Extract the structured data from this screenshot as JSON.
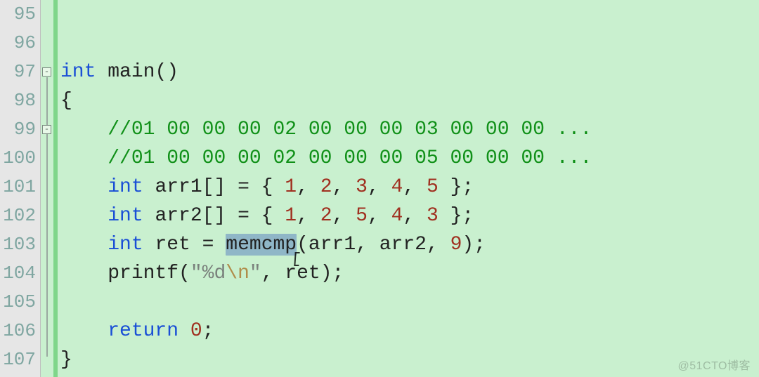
{
  "editor": {
    "line_numbers": [
      "95",
      "96",
      "97",
      "98",
      "99",
      "100",
      "101",
      "102",
      "103",
      "104",
      "105",
      "106",
      "107"
    ],
    "fold_markers": [
      {
        "line": 97,
        "glyph": "-"
      },
      {
        "line": 99,
        "glyph": "-"
      }
    ],
    "highlighted_token": "memcmp",
    "code_lines": {
      "l95": "",
      "l96": "",
      "l97": {
        "kw1": "int",
        "sp": " ",
        "id": "main",
        "pn": "()"
      },
      "l98": {
        "pn": "{"
      },
      "l99": {
        "cm": "//01 00 00 00 02 00 00 00 03 00 00 00 ..."
      },
      "l100": {
        "cm": "//01 00 00 00 02 00 00 00 05 00 00 00 ..."
      },
      "l101": {
        "kw": "int",
        "id": "arr1",
        "br": "[] = { ",
        "n1": "1",
        "n2": "2",
        "n3": "3",
        "n4": "4",
        "n5": "5",
        "end": " };"
      },
      "l102": {
        "kw": "int",
        "id": "arr2",
        "br": "[] = { ",
        "n1": "1",
        "n2": "2",
        "n3": "5",
        "n4": "4",
        "n5": "3",
        "end": " };"
      },
      "l103": {
        "kw": "int",
        "id": "ret",
        "eq": " = ",
        "fn": "memcmp",
        "args": "(arr1, arr2, ",
        "n": "9",
        "end": ");"
      },
      "l104": {
        "fn": "printf",
        "open": "(",
        "q1": "\"",
        "fmt": "%d",
        "esc": "\\n",
        "q2": "\"",
        "rest": ", ret);"
      },
      "l105": "",
      "l106": {
        "kw": "return",
        "sp": " ",
        "n": "0",
        "end": ";"
      },
      "l107": {
        "pn": "}"
      }
    }
  },
  "watermark": "@51CTO博客"
}
